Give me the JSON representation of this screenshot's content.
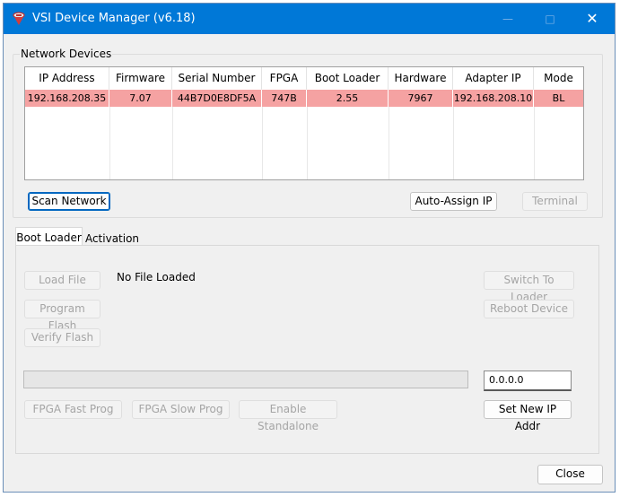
{
  "window": {
    "title": "VSI Device Manager (v6.18)",
    "accent": "#0078d7"
  },
  "network_devices": {
    "group_label": "Network Devices",
    "columns": [
      "IP Address",
      "Firmware",
      "Serial Number",
      "FPGA",
      "Boot Loader",
      "Hardware",
      "Adapter IP",
      "Mode"
    ],
    "rows": [
      [
        "192.168.208.35",
        "7.07",
        "44B7D0E8DF5A",
        "747B",
        "2.55",
        "7967",
        "192.168.208.10",
        "BL"
      ]
    ],
    "row_color": "#f5a2a2"
  },
  "toolbar": {
    "scan_label": "Scan Network",
    "auto_assign_label": "Auto-Assign IP",
    "terminal_label": "Terminal"
  },
  "tabs": [
    {
      "label": "Boot Loader",
      "selected": true
    },
    {
      "label": "Activation",
      "selected": false
    }
  ],
  "boot_loader": {
    "load_file_label": "Load File",
    "file_status": "No File Loaded",
    "program_flash_label": "Program Flash",
    "verify_flash_label": "Verify Flash",
    "switch_loader_label": "Switch To Loader",
    "reboot_label": "Reboot Device",
    "progress_percent": 0,
    "ip_value": "0.0.0.0",
    "fpga_fast_label": "FPGA Fast Prog",
    "fpga_slow_label": "FPGA Slow Prog",
    "standalone_label": "Enable Standalone",
    "set_ip_label": "Set New IP Addr"
  },
  "footer": {
    "close_label": "Close"
  }
}
